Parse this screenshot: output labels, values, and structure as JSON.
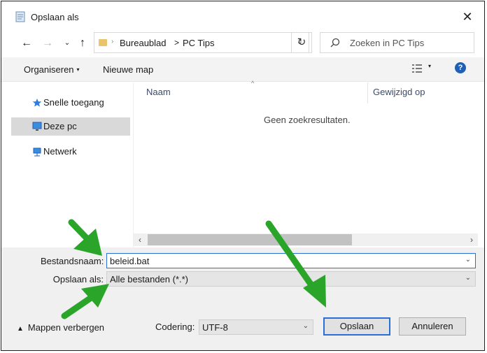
{
  "window": {
    "title": "Opslaan als"
  },
  "nav": {
    "breadcrumb": [
      "Bureaublad",
      "PC Tips"
    ],
    "search_placeholder": "Zoeken in PC Tips"
  },
  "toolbar": {
    "organize": "Organiseren",
    "new_folder": "Nieuwe map"
  },
  "sidebar": {
    "items": [
      {
        "label": "Snelle toegang",
        "icon": "star-icon",
        "selected": false
      },
      {
        "label": "Deze pc",
        "icon": "computer-icon",
        "selected": true
      },
      {
        "label": "Netwerk",
        "icon": "network-icon",
        "selected": false
      }
    ]
  },
  "files": {
    "columns": [
      "Naam",
      "Gewijzigd op"
    ],
    "empty_message": "Geen zoekresultaten."
  },
  "form": {
    "filename_label": "Bestandsnaam:",
    "filename_value": "beleid.bat",
    "savetype_label": "Opslaan als:",
    "savetype_value": "Alle bestanden  (*.*)",
    "encoding_label": "Codering:",
    "encoding_value": "UTF-8",
    "hide_folders": "Mappen verbergen",
    "save_button": "Opslaan",
    "cancel_button": "Annuleren"
  },
  "colors": {
    "accent": "#2a6fd6",
    "annotation_arrow": "#2aa52a"
  }
}
